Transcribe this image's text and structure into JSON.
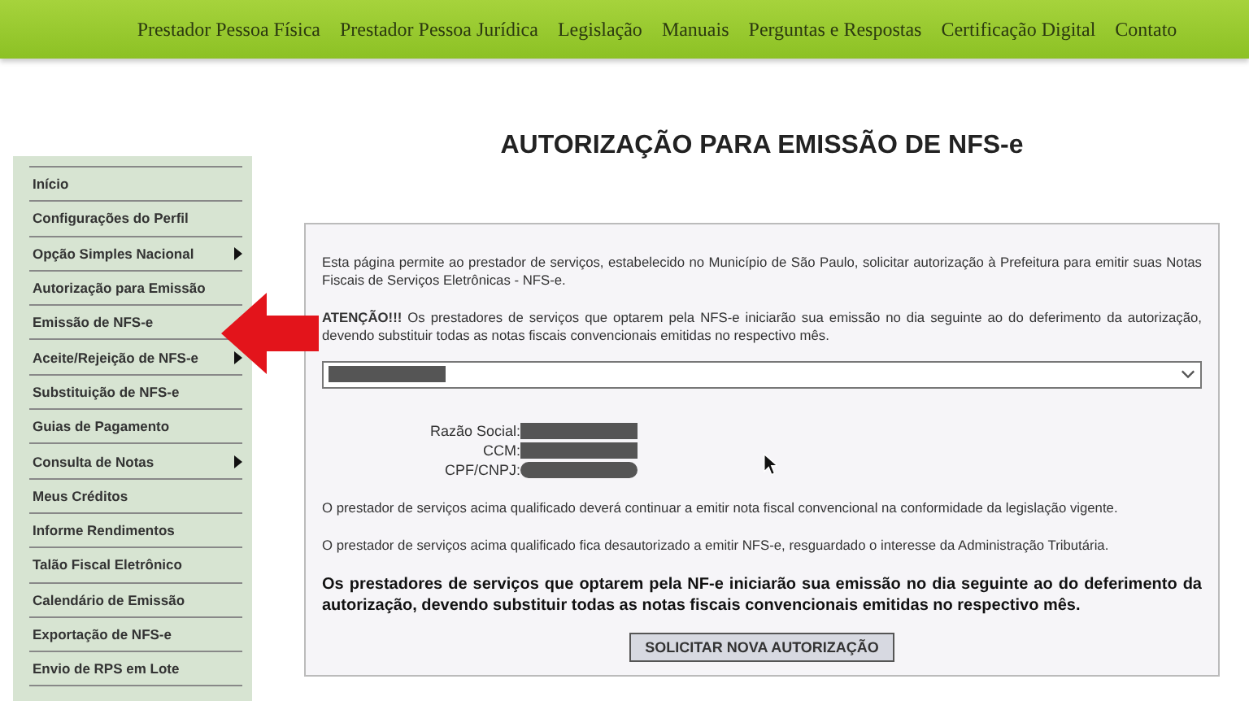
{
  "top_nav": {
    "items": [
      "Prestador Pessoa Física",
      "Prestador Pessoa Jurídica",
      "Legislação",
      "Manuais",
      "Perguntas e Respostas",
      "Certificação Digital",
      "Contato"
    ]
  },
  "sidebar": {
    "items": [
      {
        "label": "Início",
        "submenu": false
      },
      {
        "label": "Configurações do Perfil",
        "submenu": false
      },
      {
        "label": "Opção Simples Nacional",
        "submenu": true
      },
      {
        "label": "Autorização para Emissão",
        "submenu": false
      },
      {
        "label": "Emissão de NFS-e",
        "submenu": false
      },
      {
        "label": "Aceite/Rejeição de NFS-e",
        "submenu": true
      },
      {
        "label": "Substituição de NFS-e",
        "submenu": false
      },
      {
        "label": "Guias de Pagamento",
        "submenu": false
      },
      {
        "label": "Consulta de Notas",
        "submenu": true
      },
      {
        "label": "Meus Créditos",
        "submenu": false
      },
      {
        "label": "Informe Rendimentos",
        "submenu": false
      },
      {
        "label": "Talão Fiscal Eletrônico",
        "submenu": false
      },
      {
        "label": "Calendário de Emissão",
        "submenu": false
      },
      {
        "label": "Exportação de NFS-e",
        "submenu": false
      },
      {
        "label": "Envio de RPS em Lote",
        "submenu": false
      }
    ]
  },
  "page_title": "AUTORIZAÇÃO PARA EMISSÃO DE NFS-e",
  "intro": "Esta página permite ao prestador de serviços, estabelecido no Município de São Paulo, solicitar autorização à Prefeitura para emitir suas Notas Fiscais de Serviços Eletrônicas - NFS-e.",
  "warning": "**ATENÇÃO!!!** Os prestadores de serviços que optarem pela NFS-e iniciarão sua emissão no dia seguinte ao do deferimento da autorização, devendo substituir todas as notas fiscais convencionais emitidas no respectivo mês.",
  "company_fields": [
    {
      "label": "Razão Social:"
    },
    {
      "label": "CCM:"
    },
    {
      "label": "CPF/CNPJ:"
    }
  ],
  "notes": [
    "O prestador de serviços acima qualificado deverá continuar a emitir nota fiscal convencional na conformidade da legislação vigente.",
    "O prestador de serviços acima qualificado fica desautorizado a emitir NFS-e, resguardado o interesse da Administração Tributária."
  ],
  "bold_notice": "Os prestadores de serviços que optarem pela NF-e iniciarão sua emissão no dia seguinte ao do deferimento da autorização, devendo substituir todas as notas fiscais convencionais emitidas no respectivo mês.",
  "submit_button": "SOLICITAR NOVA AUTORIZAÇÃO"
}
